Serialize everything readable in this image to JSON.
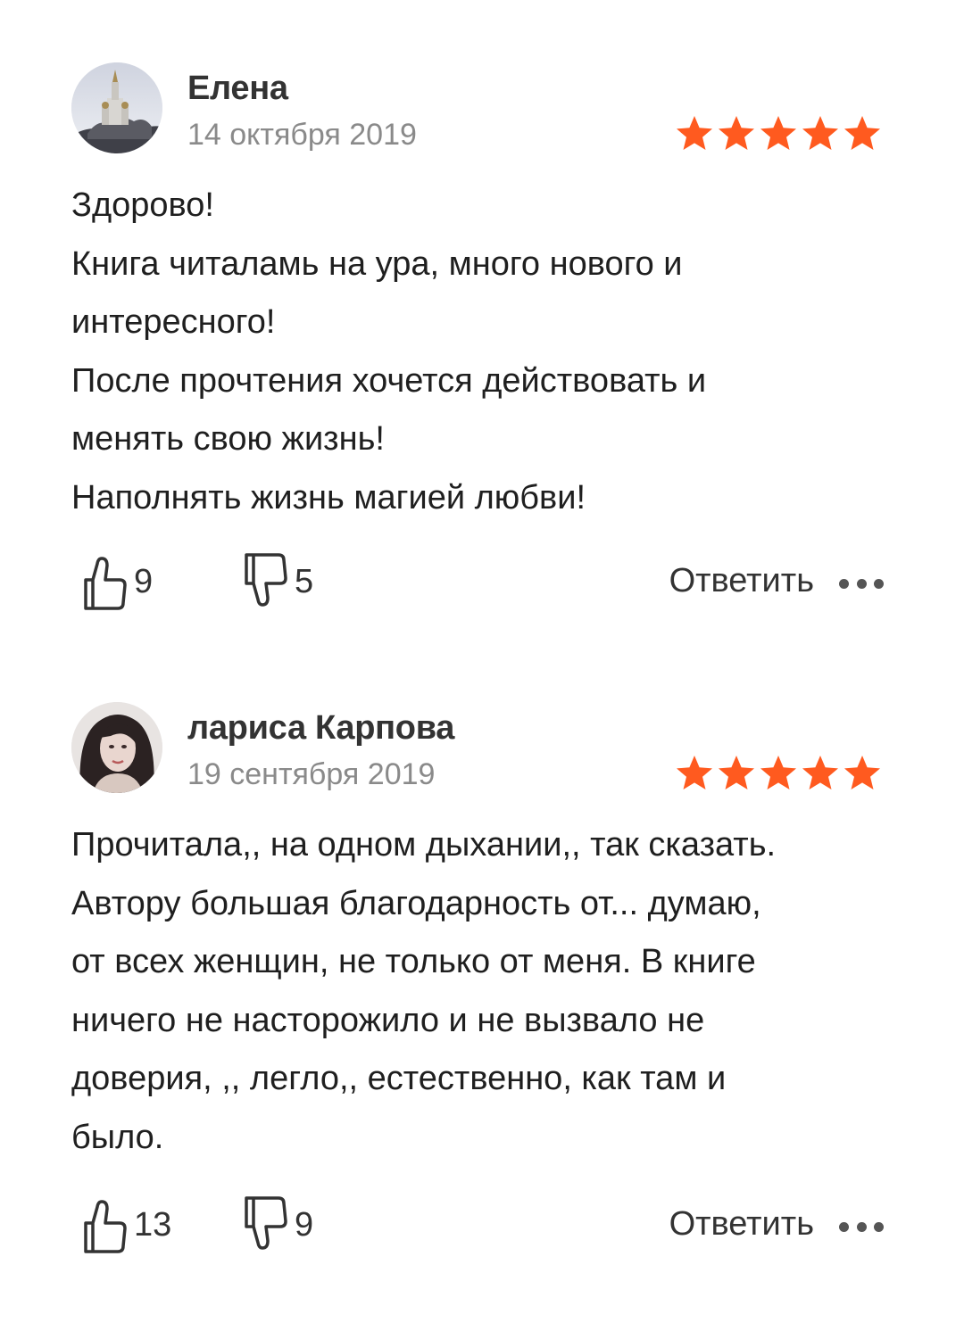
{
  "colors": {
    "star": "#ff5a1f",
    "text": "#1f1f1f",
    "muted": "#8a8a8a"
  },
  "reviews": [
    {
      "author": "Елена",
      "date": "14 октября 2019",
      "rating": 5,
      "avatar_icon": "church-photo-avatar",
      "lines": [
        "Здорово!",
        "Книга читаламь на ура, много нового и",
        "интересного!",
        "После прочтения хочется действовать и",
        "менять свою жизнь!",
        "Наполнять жизнь магией любви!"
      ],
      "likes": "9",
      "dislikes": "5",
      "reply_label": "Ответить"
    },
    {
      "author": "лариса Карпова",
      "date": "19 сентября 2019",
      "rating": 5,
      "avatar_icon": "woman-portrait-avatar",
      "lines": [
        "Прочитала,, на одном дыхании,, так сказать.",
        "Автору большая благодарность от... думаю,",
        "от всех женщин, не только от меня. В книге",
        "ничего не насторожило и не вызвало не",
        "доверия, ,, легло,, естественно, как там и",
        "было."
      ],
      "likes": "13",
      "dislikes": "9",
      "reply_label": "Ответить"
    }
  ]
}
